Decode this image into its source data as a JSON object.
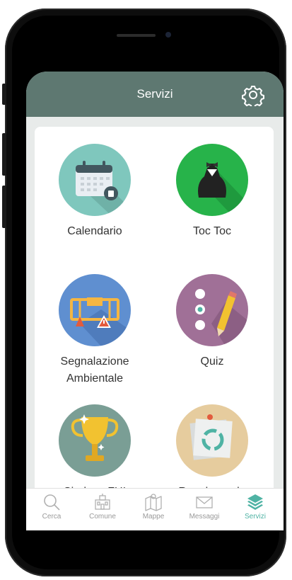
{
  "header": {
    "title": "Servizi"
  },
  "tiles": [
    {
      "label": "Calendario",
      "color": "#7fc7bd"
    },
    {
      "label": "Toc Toc",
      "color": "#27b34a"
    },
    {
      "label": "Segnalazione Ambientale",
      "color": "#5f8fd0"
    },
    {
      "label": "Quiz",
      "color": "#a07097"
    },
    {
      "label": "Sindaco FUI",
      "color": "#7a9e95"
    },
    {
      "label": "Regole per la",
      "color": "#e6cc9e"
    }
  ],
  "tabbar": {
    "items": [
      {
        "label": "Cerca",
        "icon": "search-icon"
      },
      {
        "label": "Comune",
        "icon": "town-hall-icon"
      },
      {
        "label": "Mappe",
        "icon": "map-icon"
      },
      {
        "label": "Messaggi",
        "icon": "mail-icon"
      },
      {
        "label": "Servizi",
        "icon": "layers-icon",
        "active": true
      }
    ],
    "active_color": "#4fb3a4"
  }
}
